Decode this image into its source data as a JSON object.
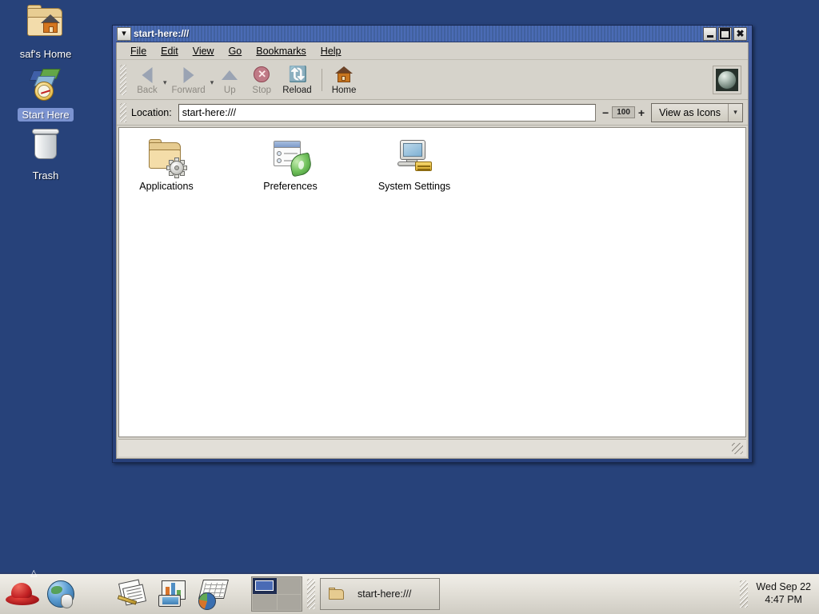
{
  "desktop": {
    "background_color": "#27427a",
    "icons": [
      {
        "label": "saf's Home",
        "icon": "home-folder-icon",
        "selected": false
      },
      {
        "label": "Start Here",
        "icon": "start-here-icon",
        "selected": true
      },
      {
        "label": "Trash",
        "icon": "trash-icon",
        "selected": false
      }
    ]
  },
  "window": {
    "title": "start-here:///",
    "window_menu_icon": "chevron-down-icon",
    "controls": {
      "minimize": "minimize-icon",
      "maximize": "maximize-icon",
      "close": "close-icon"
    },
    "menubar": [
      {
        "label": "File",
        "accel": "F"
      },
      {
        "label": "Edit",
        "accel": "E"
      },
      {
        "label": "View",
        "accel": "V"
      },
      {
        "label": "Go",
        "accel": "G"
      },
      {
        "label": "Bookmarks",
        "accel": "B"
      },
      {
        "label": "Help",
        "accel": "H"
      }
    ],
    "toolbar": {
      "back": {
        "label": "Back",
        "icon": "arrow-left-icon",
        "disabled": true
      },
      "back_menu": {
        "icon": "chevron-down-icon"
      },
      "forward": {
        "label": "Forward",
        "icon": "arrow-right-icon",
        "disabled": true
      },
      "forward_menu": {
        "icon": "chevron-down-icon"
      },
      "up": {
        "label": "Up",
        "icon": "arrow-up-icon",
        "disabled": true
      },
      "stop": {
        "label": "Stop",
        "icon": "stop-icon",
        "disabled": true
      },
      "reload": {
        "label": "Reload",
        "icon": "reload-icon",
        "disabled": false
      },
      "home": {
        "label": "Home",
        "icon": "house-icon",
        "disabled": false
      },
      "throbber": {
        "icon": "throbber-orb-icon"
      }
    },
    "location_bar": {
      "label": "Location:",
      "value": "start-here:///",
      "placeholder": "",
      "zoom_out_label": "−",
      "zoom_level": "100",
      "zoom_in_label": "+",
      "view_as_label": "View as Icons",
      "view_as_arrow": "chevron-down-icon"
    },
    "contents": [
      {
        "label": "Applications",
        "icon": "folder-gear-icon"
      },
      {
        "label": "Preferences",
        "icon": "preferences-dialog-icon"
      },
      {
        "label": "System Settings",
        "icon": "monitor-toolbox-icon"
      }
    ],
    "statusbar": {
      "text": ""
    }
  },
  "taskbar": {
    "launchers": [
      {
        "name": "Red Hat Menu",
        "icon": "redhat-menu-icon"
      },
      {
        "name": "Web Browser",
        "icon": "web-browser-globe-icon"
      },
      {
        "name": "Word Processor",
        "icon": "writer-document-icon"
      },
      {
        "name": "Presentation",
        "icon": "presentation-chart-icon"
      },
      {
        "name": "Spreadsheet",
        "icon": "spreadsheet-pie-icon"
      }
    ],
    "workspaces": {
      "count": 4,
      "active_index": 0
    },
    "tasks": [
      {
        "label": "start-here:///",
        "icon": "folder-icon",
        "active": true
      }
    ],
    "clock": {
      "date": "Wed Sep 22",
      "time": "4:47 PM"
    }
  }
}
